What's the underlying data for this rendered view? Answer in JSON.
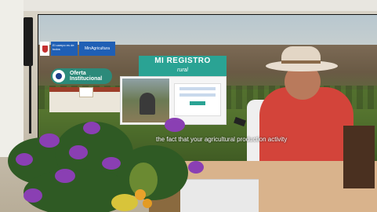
{
  "screen": {
    "logo_campo": "El campo es de todos",
    "logo_ministry": "MinAgricultura",
    "oferta_label": "Oferta Institucional",
    "registro_title": "MI REGISTRO",
    "registro_subtitle": "rural",
    "subtitle_text": "the fact that your agricultural production activity"
  },
  "colors": {
    "accent_teal": "#2aa394",
    "brand_blue": "#1f5fb5",
    "vest_red": "#d3443a",
    "flower_purple": "#8a3fb3"
  }
}
